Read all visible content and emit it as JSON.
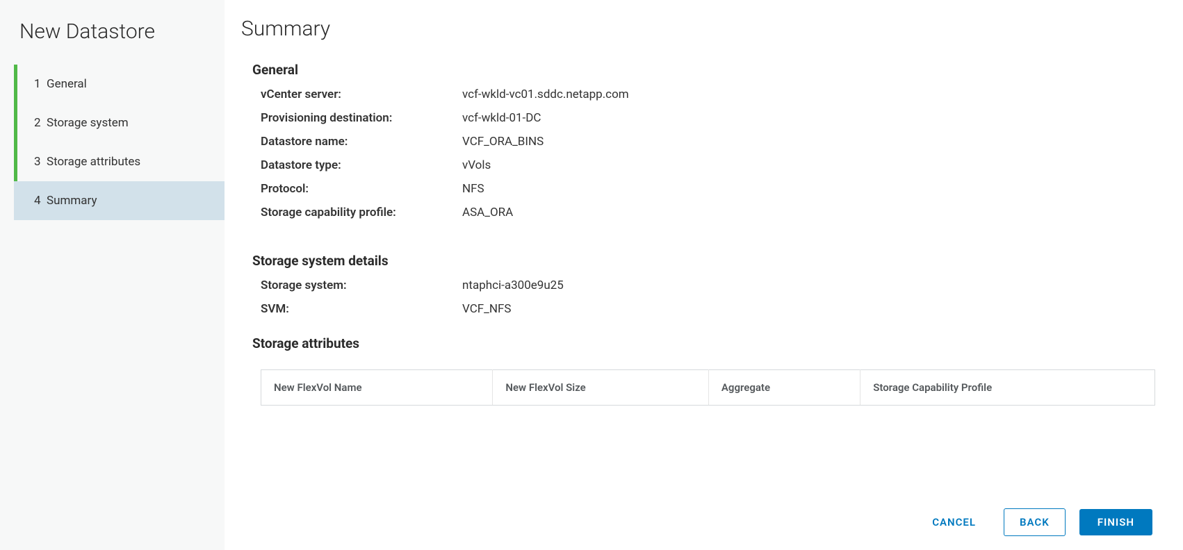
{
  "sidebar": {
    "title": "New Datastore",
    "steps": [
      {
        "num": "1",
        "label": "General"
      },
      {
        "num": "2",
        "label": "Storage system"
      },
      {
        "num": "3",
        "label": "Storage attributes"
      },
      {
        "num": "4",
        "label": "Summary"
      }
    ]
  },
  "main": {
    "title": "Summary",
    "sections": {
      "general": {
        "heading": "General",
        "rows": [
          {
            "label": "vCenter server:",
            "value": "vcf-wkld-vc01.sddc.netapp.com"
          },
          {
            "label": "Provisioning destination:",
            "value": "vcf-wkld-01-DC"
          },
          {
            "label": "Datastore name:",
            "value": "VCF_ORA_BINS"
          },
          {
            "label": "Datastore type:",
            "value": "vVols"
          },
          {
            "label": "Protocol:",
            "value": "NFS"
          },
          {
            "label": "Storage capability profile:",
            "value": "ASA_ORA"
          }
        ]
      },
      "storage_system": {
        "heading": "Storage system details",
        "rows": [
          {
            "label": "Storage system:",
            "value": "ntaphci-a300e9u25"
          },
          {
            "label": "SVM:",
            "value": "VCF_NFS"
          }
        ]
      },
      "storage_attributes": {
        "heading": "Storage attributes",
        "columns": [
          "New FlexVol Name",
          "New FlexVol Size",
          "Aggregate",
          "Storage Capability Profile"
        ]
      }
    }
  },
  "footer": {
    "cancel": "CANCEL",
    "back": "BACK",
    "finish": "FINISH"
  }
}
